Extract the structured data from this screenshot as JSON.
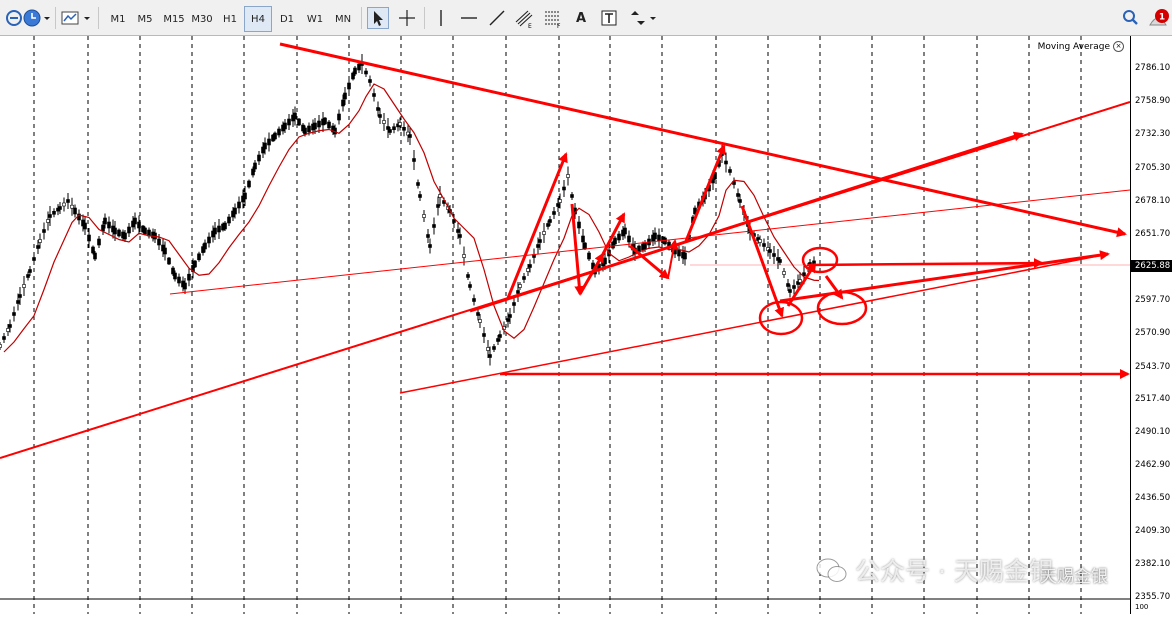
{
  "toolbar": {
    "timeframes": [
      "M1",
      "M5",
      "M15",
      "M30",
      "H1",
      "H4",
      "D1",
      "W1",
      "MN"
    ],
    "active_timeframe": "H4",
    "text_tool": "A",
    "notification_count": "1"
  },
  "indicator": {
    "label": "Moving Average"
  },
  "price_axis": {
    "ticks": [
      "2786.10",
      "2758.90",
      "2732.30",
      "2705.30",
      "2678.10",
      "2651.70",
      "2597.70",
      "2570.90",
      "2543.70",
      "2517.40",
      "2490.10",
      "2462.90",
      "2436.50",
      "2409.30",
      "2382.10",
      "2355.70"
    ],
    "current_price": "2625.88"
  },
  "bottom_panel": {
    "scale_label": "100"
  },
  "watermark": {
    "text": "公众号 · 天赐金银",
    "corner_text": "天赐金银"
  },
  "colors": {
    "annotation": "#ff0000",
    "ma_line": "#c00000",
    "candles": "#000000",
    "grid": "#000000"
  }
}
